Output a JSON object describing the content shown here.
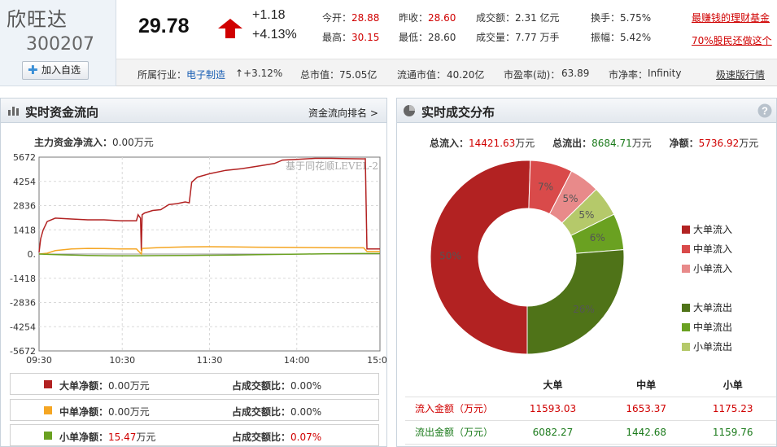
{
  "stock": {
    "name": "欣旺达",
    "code": "300207",
    "add_label": "加入自选"
  },
  "quote": {
    "price": "29.78",
    "change": "+1.18",
    "change_pct": "+4.13%",
    "fields": [
      {
        "label": "今开：",
        "value": "28.88",
        "color": "red"
      },
      {
        "label": "昨收：",
        "value": "28.60",
        "color": "red"
      },
      {
        "label": "成交额：",
        "value": "2.31 亿元",
        "color": "plain"
      },
      {
        "label": "换手：",
        "value": "5.75%",
        "color": "plain"
      },
      {
        "label": "最高：",
        "value": "30.15",
        "color": "red"
      },
      {
        "label": "最低：",
        "value": "28.60",
        "color": "plain"
      },
      {
        "label": "成交量：",
        "value": "7.77 万手",
        "color": "plain"
      },
      {
        "label": "振幅：",
        "value": "5.42%",
        "color": "plain"
      }
    ],
    "promo_links": [
      "最赚钱的理财基金",
      "70%股民还做这个"
    ]
  },
  "industry_row": {
    "industry_label": "所属行业：",
    "industry": "电子制造",
    "industry_change": "+3.12%",
    "total_cap_label": "总市值：",
    "total_cap": "75.05亿",
    "float_cap_label": "流通市值：",
    "float_cap": "40.20亿",
    "pe_label": "市盈率(动)：",
    "pe": "63.89",
    "pb_label": "市净率：",
    "pb": "Infinity",
    "quick_link": "极速版行情"
  },
  "flow_panel": {
    "title": "实时资金流向",
    "rank_link": "资金流向排名 >",
    "net_label": "主力资金净流入：",
    "net_value": "0.00",
    "net_unit": "万元",
    "watermark": "基于同花顺LEVEL-2",
    "legend": [
      {
        "label": "大单净额：",
        "value": "0.00",
        "unit": "万元",
        "ratio_label": "占成交额比：",
        "ratio": "0.00%",
        "color": "#b22222",
        "value_color": "plain",
        "ratio_color": "plain"
      },
      {
        "label": "中单净额：",
        "value": "0.00",
        "unit": "万元",
        "ratio_label": "占成交额比：",
        "ratio": "0.00%",
        "color": "#f5a623",
        "value_color": "plain",
        "ratio_color": "plain"
      },
      {
        "label": "小单净额：",
        "value": "15.47",
        "unit": "万元",
        "ratio_label": "占成交额比：",
        "ratio": "0.07%",
        "color": "#6aa121",
        "value_color": "red",
        "ratio_color": "red"
      }
    ]
  },
  "dist_panel": {
    "title": "实时成交分布",
    "inflow_label": "总流入：",
    "inflow": "14421.63",
    "outflow_label": "总流出：",
    "outflow": "8684.71",
    "net_label": "净额：",
    "net": "5736.92",
    "unit": "万元",
    "legend": [
      {
        "label": "大单流入",
        "color": "#b22222"
      },
      {
        "label": "中单流入",
        "color": "#d94a4a"
      },
      {
        "label": "小单流入",
        "color": "#e88a8a"
      },
      {
        "label": "大单流出",
        "color": "#4f7318"
      },
      {
        "label": "中单流出",
        "color": "#6aa121"
      },
      {
        "label": "小单流出",
        "color": "#b5c96a"
      }
    ],
    "table": {
      "headers": [
        "",
        "大单",
        "中单",
        "小单"
      ],
      "rows": [
        {
          "label": "流入金额（万元）",
          "values": [
            "11593.03",
            "1653.37",
            "1175.23"
          ],
          "color": "red"
        },
        {
          "label": "流出金额（万元）",
          "values": [
            "6082.27",
            "1442.68",
            "1159.76"
          ],
          "color": "green"
        }
      ]
    }
  },
  "chart_data": [
    {
      "type": "line",
      "x_ticks": [
        "09:30",
        "10:30",
        "11:30",
        "14:00",
        "15:00"
      ],
      "y_ticks": [
        "5672",
        "4254",
        "2836",
        "1418",
        "0.",
        "-1418",
        "-2836",
        "-4254",
        "-5672"
      ],
      "ylim": [
        -5672,
        5672
      ],
      "grid": true,
      "series": [
        {
          "color": "#b22222",
          "points": [
            [
              0,
              100
            ],
            [
              2,
              900
            ],
            [
              5,
              1400
            ],
            [
              10,
              1900
            ],
            [
              20,
              2100
            ],
            [
              40,
              2050
            ],
            [
              60,
              2000
            ],
            [
              80,
              2000
            ],
            [
              100,
              1950
            ],
            [
              120,
              1950
            ],
            [
              122,
              2300
            ],
            [
              125,
              2100
            ],
            [
              126,
              200
            ],
            [
              127,
              2300
            ],
            [
              130,
              2400
            ],
            [
              140,
              2550
            ],
            [
              150,
              2600
            ],
            [
              160,
              2900
            ],
            [
              170,
              2950
            ],
            [
              180,
              3050
            ],
            [
              185,
              3000
            ],
            [
              188,
              4200
            ],
            [
              195,
              4500
            ],
            [
              210,
              4700
            ],
            [
              230,
              4900
            ],
            [
              250,
              5000
            ],
            [
              270,
              5150
            ],
            [
              290,
              5300
            ],
            [
              300,
              5500
            ],
            [
              320,
              5550
            ],
            [
              340,
              5600
            ],
            [
              360,
              5600
            ],
            [
              380,
              5580
            ],
            [
              400,
              5570
            ],
            [
              402,
              5580
            ],
            [
              404,
              300
            ],
            [
              420,
              300
            ]
          ]
        },
        {
          "color": "#f5a623",
          "points": [
            [
              0,
              0
            ],
            [
              10,
              50
            ],
            [
              20,
              200
            ],
            [
              40,
              300
            ],
            [
              60,
              330
            ],
            [
              80,
              320
            ],
            [
              100,
              300
            ],
            [
              120,
              300
            ],
            [
              126,
              0
            ],
            [
              127,
              330
            ],
            [
              150,
              380
            ],
            [
              180,
              420
            ],
            [
              210,
              430
            ],
            [
              240,
              420
            ],
            [
              270,
              400
            ],
            [
              300,
              390
            ],
            [
              330,
              380
            ],
            [
              360,
              370
            ],
            [
              400,
              360
            ],
            [
              404,
              150
            ],
            [
              420,
              150
            ]
          ]
        },
        {
          "color": "#6aa121",
          "points": [
            [
              0,
              0
            ],
            [
              10,
              -20
            ],
            [
              30,
              -50
            ],
            [
              60,
              -80
            ],
            [
              90,
              -100
            ],
            [
              120,
              -100
            ],
            [
              150,
              -90
            ],
            [
              180,
              -80
            ],
            [
              210,
              -70
            ],
            [
              240,
              -60
            ],
            [
              270,
              -40
            ],
            [
              300,
              -20
            ],
            [
              330,
              0
            ],
            [
              360,
              20
            ],
            [
              400,
              30
            ],
            [
              420,
              30
            ]
          ]
        }
      ]
    },
    {
      "type": "pie",
      "donut": true,
      "slices": [
        {
          "label": "大单流入",
          "value": 50,
          "color": "#b22222",
          "text": "50%"
        },
        {
          "label": "中单流入",
          "value": 7,
          "color": "#d94a4a",
          "text": "7%"
        },
        {
          "label": "小单流入",
          "value": 5,
          "color": "#e88a8a",
          "text": "5%"
        },
        {
          "label": "小单流出",
          "value": 5,
          "color": "#b5c96a",
          "text": "5%"
        },
        {
          "label": "中单流出",
          "value": 6,
          "color": "#6aa121",
          "text": "6%"
        },
        {
          "label": "大单流出",
          "value": 26,
          "color": "#4f7318",
          "text": "26%"
        }
      ]
    }
  ]
}
